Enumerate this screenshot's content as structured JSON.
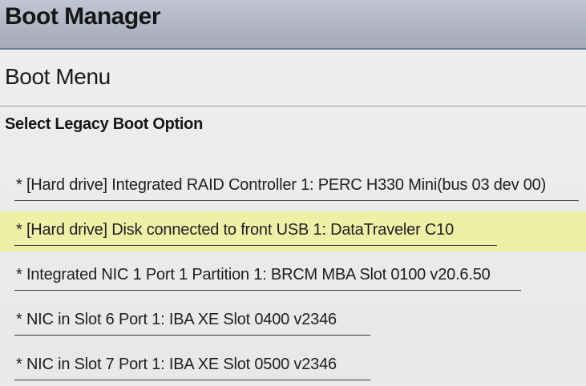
{
  "header": {
    "title": "Boot Manager"
  },
  "menu": {
    "title": "Boot Menu",
    "section_title": "Select Legacy Boot Option"
  },
  "options": [
    {
      "label": "* [Hard drive] Integrated RAID Controller 1: PERC H330 Mini(bus 03 dev 00)",
      "selected": false
    },
    {
      "label": "* [Hard drive] Disk connected to front USB 1: DataTraveler C10",
      "selected": true
    },
    {
      "label": "* Integrated NIC 1 Port 1 Partition 1: BRCM MBA Slot 0100 v20.6.50",
      "selected": false
    },
    {
      "label": "* NIC in Slot 6 Port 1: IBA XE Slot 0400 v2346",
      "selected": false
    },
    {
      "label": "* NIC in Slot 7 Port 1: IBA XE Slot 0500 v2346",
      "selected": false
    }
  ],
  "colors": {
    "title_bar": "#b0b5c3",
    "selected_highlight": "#eef0a8",
    "background": "#eceae9"
  }
}
